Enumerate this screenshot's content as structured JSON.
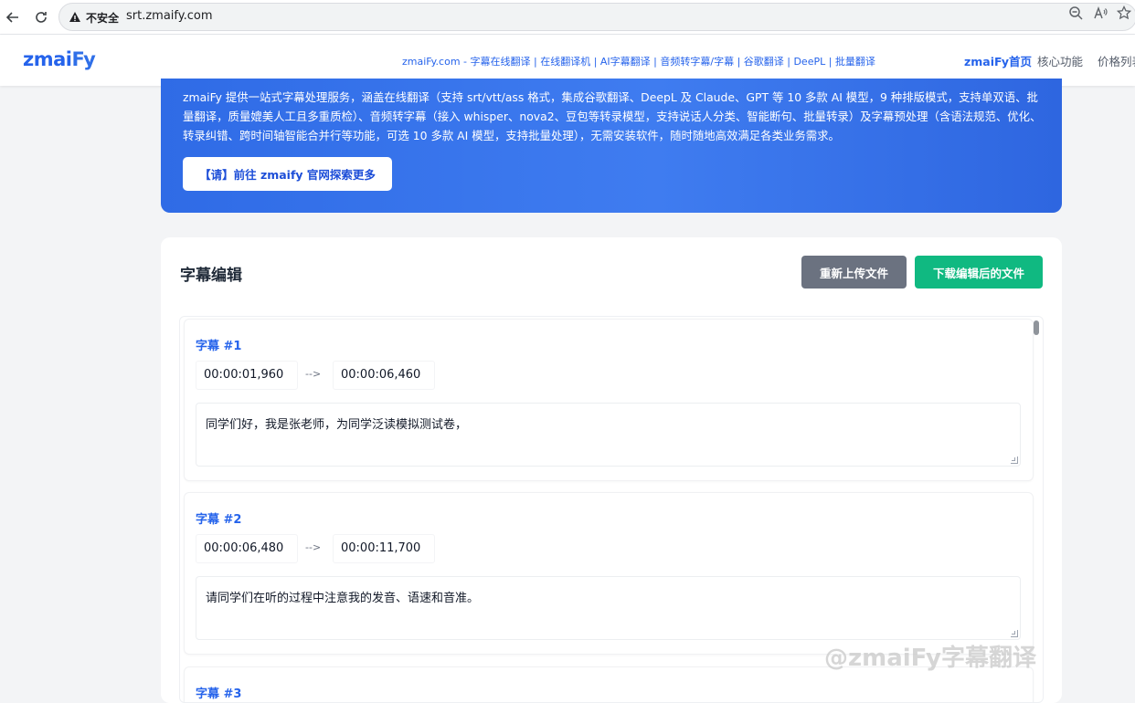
{
  "browser": {
    "insecure_label": "不安全",
    "url": "srt.zmaify.com"
  },
  "header": {
    "logo_prefix": "zmai",
    "logo_suffix": "Fy",
    "nav_text": "zmaiFy.com - 字幕在线翻译 | 在线翻译机 | AI字幕翻译 | 音频转字幕/字幕 | 谷歌翻译 | DeePL | 批量翻译",
    "links": [
      {
        "label": "zmaiFy首页"
      },
      {
        "label": "核心功能"
      },
      {
        "label": "价格列表"
      }
    ]
  },
  "hero": {
    "description": "zmaiFy 提供一站式字幕处理服务，涵盖在线翻译（支持 srt/vtt/ass 格式，集成谷歌翻译、DeepL 及 Claude、GPT 等 10 多款 AI 模型，9 种排版模式，支持单双语、批量翻译，质量媲美人工且多重质检）、音频转字幕（接入 whisper、nova2、豆包等转录模型，支持说话人分类、智能断句、批量转录）及字幕预处理（含语法规范、优化、转录纠错、跨时间轴智能合并行等功能，可选 10 多款 AI 模型，支持批量处理），无需安装软件，随时随地高效满足各类业务需求。",
    "cta_label": "【请】前往 zmaify 官网探索更多"
  },
  "editor": {
    "title": "字幕编辑",
    "reupload_label": "重新上传文件",
    "download_label": "下载编辑后的文件",
    "arrow": "-->",
    "subtitles": [
      {
        "label": "字幕 #1",
        "start": "00:00:01,960",
        "end": "00:00:06,460",
        "text": "同学们好，我是张老师，为同学泛读模拟测试卷，"
      },
      {
        "label": "字幕 #2",
        "start": "00:00:06,480",
        "end": "00:00:11,700",
        "text": "请同学们在听的过程中注意我的发音、语速和音准。"
      },
      {
        "label": "字幕 #3"
      }
    ]
  },
  "watermark": "@zmaiFy字幕翻译",
  "colors": {
    "accent": "#2563eb",
    "download_button": "#10b981",
    "reupload_button": "#6b7280"
  }
}
